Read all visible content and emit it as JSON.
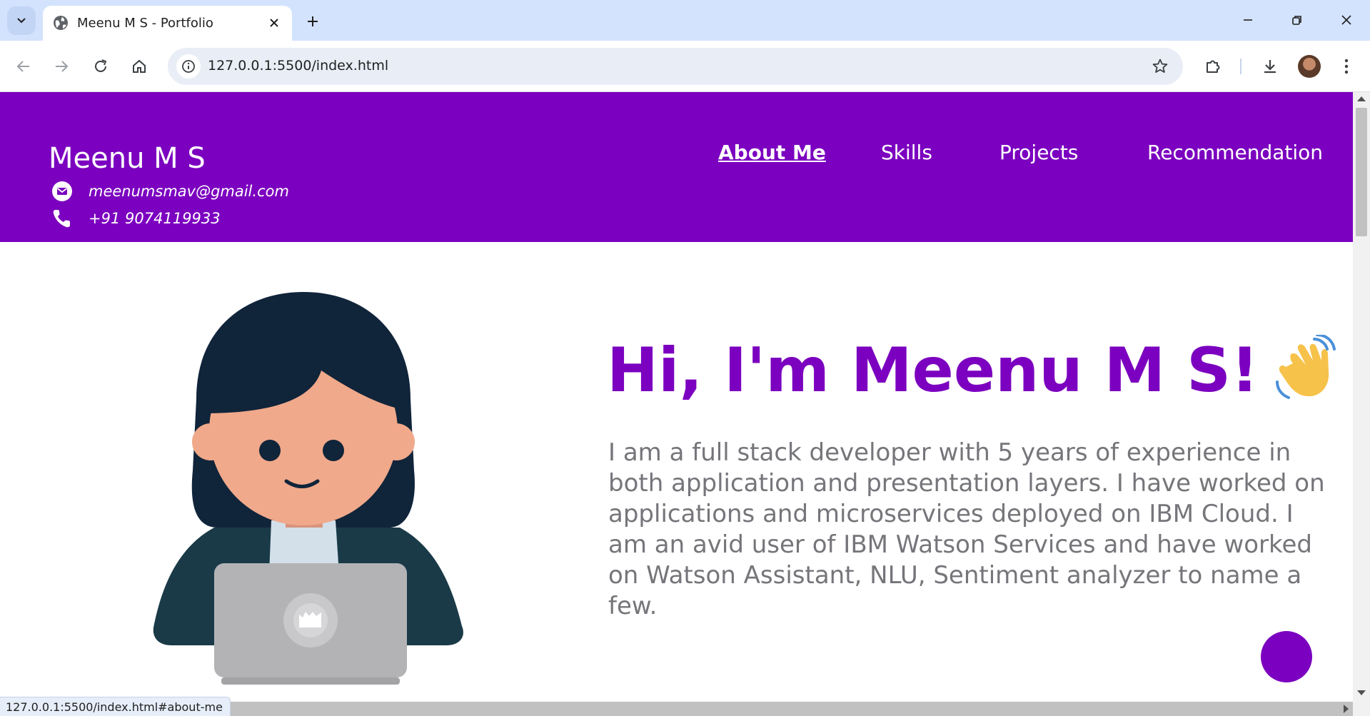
{
  "browser": {
    "tab_title": "Meenu M S - Portfolio",
    "url": "127.0.0.1:5500/index.html",
    "status_url": "127.0.0.1:5500/index.html#about-me"
  },
  "header": {
    "name": "Meenu M S",
    "email": "meenumsmav@gmail.com",
    "phone": "+91 9074119933",
    "nav": [
      {
        "label": "About Me",
        "active": true
      },
      {
        "label": "Skills",
        "active": false
      },
      {
        "label": "Projects",
        "active": false
      },
      {
        "label": "Recommendation",
        "active": false
      }
    ]
  },
  "hero": {
    "heading": "Hi, I'm Meenu M S!",
    "bio": "I am a full stack developer with 5 years of experience in both application and presentation layers. I have worked on applications and microservices deployed on IBM Cloud. I am an avid user of IBM Watson Services and have worked on Watson Assistant, NLU, Sentiment analyzer to name a few."
  },
  "colors": {
    "brand": "#7b00bf",
    "bio_text": "#75757a",
    "chrome_tabstrip": "#d3e3fd"
  },
  "icons": [
    "globe-icon",
    "email-icon",
    "phone-icon",
    "waving-hand-icon",
    "star-icon",
    "extensions-icon",
    "download-icon"
  ]
}
